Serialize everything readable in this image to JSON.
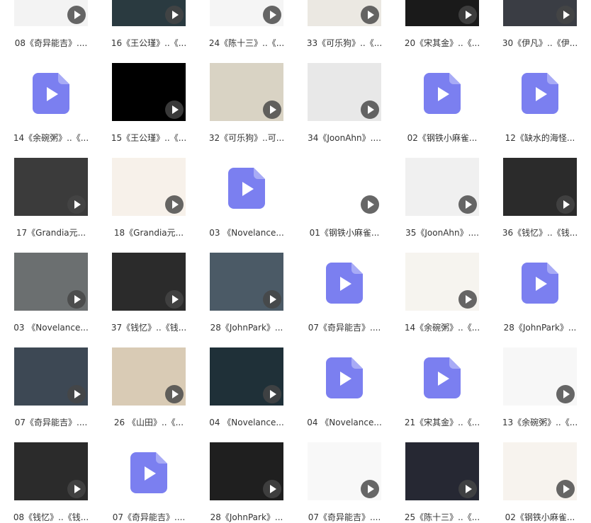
{
  "colors": {
    "background": "#ffffff",
    "label_text": "#333333",
    "video_file_icon": "#7b7ff0",
    "video_file_icon_fold": "#a8abf6",
    "play_badge": "#464646"
  },
  "icons": {
    "video_thumbnail_overlay": "play-icon",
    "generic_video_file": "video-file-icon"
  },
  "rows": [
    [
      {
        "label": "08《奇异能吉》....",
        "kind": "thumbnail",
        "bg": "#f3f3f3"
      },
      {
        "label": "16《王公瑾》..《...",
        "kind": "thumbnail",
        "bg": "#2a3a40"
      },
      {
        "label": "24《陈十三》..《...",
        "kind": "thumbnail",
        "bg": "#f5f5f5"
      },
      {
        "label": "33《可乐狗》..《...",
        "kind": "thumbnail",
        "bg": "#ebe8e2"
      },
      {
        "label": "20《宋其金》..《...",
        "kind": "thumbnail",
        "bg": "#1a1a1a"
      },
      {
        "label": "30《伊凡》..《伊...",
        "kind": "thumbnail",
        "bg": "#3a3d44"
      }
    ],
    [
      {
        "label": "14《余碗粥》..《...",
        "kind": "file"
      },
      {
        "label": "15《王公瑾》..《...",
        "kind": "thumbnail",
        "bg": "#000000"
      },
      {
        "label": "32《可乐狗》..可...",
        "kind": "thumbnail",
        "bg": "#d9d3c4"
      },
      {
        "label": "34《JoonAhn》....",
        "kind": "thumbnail",
        "bg": "#e8e8e8"
      },
      {
        "label": "02《钢铁小麻雀...",
        "kind": "file"
      },
      {
        "label": "12《缺水的海怪...",
        "kind": "file"
      }
    ],
    [
      {
        "label": "17《Grandia元...",
        "kind": "thumbnail",
        "bg": "#3b3b3b"
      },
      {
        "label": "18《Grandia元...",
        "kind": "thumbnail",
        "bg": "#f7f1ea"
      },
      {
        "label": "03 《Novelance...",
        "kind": "file"
      },
      {
        "label": "01《钢铁小麻雀...",
        "kind": "thumbnail",
        "bg": "#ffffff"
      },
      {
        "label": "35《JoonAhn》....",
        "kind": "thumbnail",
        "bg": "#f0f0f0"
      },
      {
        "label": "36《钱忆》..《钱...",
        "kind": "thumbnail",
        "bg": "#2b2b2b"
      }
    ],
    [
      {
        "label": "03 《Novelance...",
        "kind": "thumbnail",
        "bg": "#6b6f70"
      },
      {
        "label": "37《钱忆》..《钱...",
        "kind": "thumbnail",
        "bg": "#2b2b2b"
      },
      {
        "label": "28《JohnPark》...",
        "kind": "thumbnail",
        "bg": "#4b5a66"
      },
      {
        "label": "07《奇异能吉》....",
        "kind": "file"
      },
      {
        "label": "14《余碗粥》..《...",
        "kind": "thumbnail",
        "bg": "#f6f4ef"
      },
      {
        "label": "28《JohnPark》...",
        "kind": "file"
      }
    ],
    [
      {
        "label": "07《奇异能吉》....",
        "kind": "thumbnail",
        "bg": "#3d4854"
      },
      {
        "label": "26 《山田》..《...",
        "kind": "thumbnail",
        "bg": "#d9cbb5"
      },
      {
        "label": "04 《Novelance...",
        "kind": "thumbnail",
        "bg": "#1f3038"
      },
      {
        "label": "04 《Novelance...",
        "kind": "file"
      },
      {
        "label": "21《宋其金》..《...",
        "kind": "file"
      },
      {
        "label": "13《余碗粥》..《...",
        "kind": "thumbnail",
        "bg": "#f7f7f7"
      }
    ],
    [
      {
        "label": "08《钱忆》..《钱...",
        "kind": "thumbnail",
        "bg": "#2b2b2b"
      },
      {
        "label": "07《奇异能吉》....",
        "kind": "file"
      },
      {
        "label": "28《JohnPark》...",
        "kind": "thumbnail",
        "bg": "#1f1f1f"
      },
      {
        "label": "07《奇异能吉》....",
        "kind": "thumbnail",
        "bg": "#f8f8f8"
      },
      {
        "label": "25《陈十三》..《...",
        "kind": "thumbnail",
        "bg": "#262833"
      },
      {
        "label": "02《钢铁小麻雀...",
        "kind": "thumbnail",
        "bg": "#f7f3ee"
      }
    ]
  ]
}
